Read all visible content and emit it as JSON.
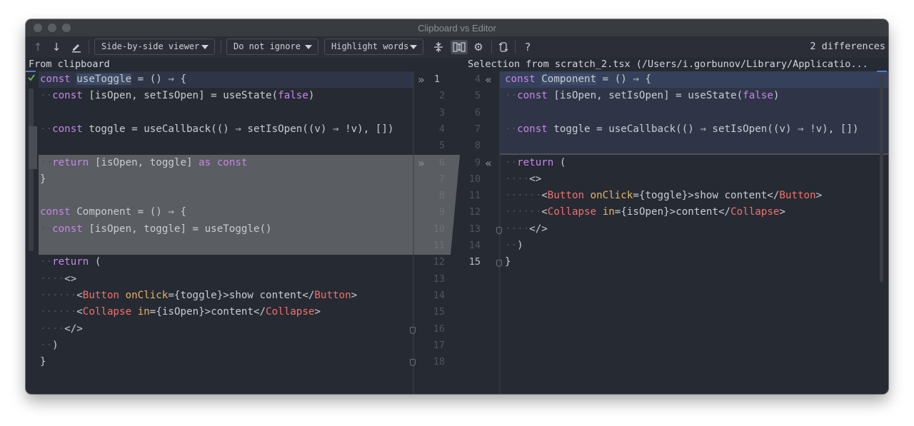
{
  "window": {
    "title": "Clipboard vs Editor"
  },
  "toolbar": {
    "viewer_label": "Side-by-side viewer",
    "ignore_label": "Do not ignore",
    "highlight_label": "Highlight words",
    "help_label": "?",
    "diff_count": "2 differences"
  },
  "left": {
    "header": "From clipboard",
    "lines": [
      "const useToggle = () ⇒ {",
      "  const [isOpen, setIsOpen] = useState(false)",
      "",
      "  const toggle = useCallback(() ⇒ setIsOpen((v) ⇒ !v), [])",
      "",
      "  return [isOpen, toggle] as const",
      "}",
      "",
      "const Component = () ⇒ {",
      "  const [isOpen, toggle] = useToggle()",
      "",
      "  return (",
      "    <>",
      "      <Button onClick={toggle}>show content</Button>",
      "      <Collapse in={isOpen}>content</Collapse>",
      "    </>",
      "  )",
      "}"
    ],
    "line_numbers": [
      "1",
      "2",
      "3",
      "4",
      "5",
      "6",
      "7",
      "8",
      "9",
      "10",
      "11",
      "12",
      "13",
      "14",
      "15",
      "16",
      "17",
      "18"
    ]
  },
  "right": {
    "header": "Selection from scratch_2.tsx (/Users/i.gorbunov/Library/Applicatio...",
    "lines": [
      "const Component = () ⇒ {",
      "  const [isOpen, setIsOpen] = useState(false)",
      "",
      "  const toggle = useCallback(() ⇒ setIsOpen((v) ⇒ !v), [])",
      "",
      "  return (",
      "    <>",
      "      <Button onClick={toggle}>show content</Button>",
      "      <Collapse in={isOpen}>content</Collapse>",
      "    </>",
      "  )",
      "}"
    ],
    "line_numbers": [
      "4",
      "5",
      "6",
      "7",
      "8",
      "9",
      "10",
      "11",
      "12",
      "13",
      "14",
      "15"
    ]
  },
  "colors": {
    "background": "#262a33",
    "keyword": "#c586e8",
    "jsx_tag": "#f2716b",
    "jsx_attr": "#e6b563",
    "changed_block": "#5a5d62",
    "modified_block": "#2f3546"
  }
}
